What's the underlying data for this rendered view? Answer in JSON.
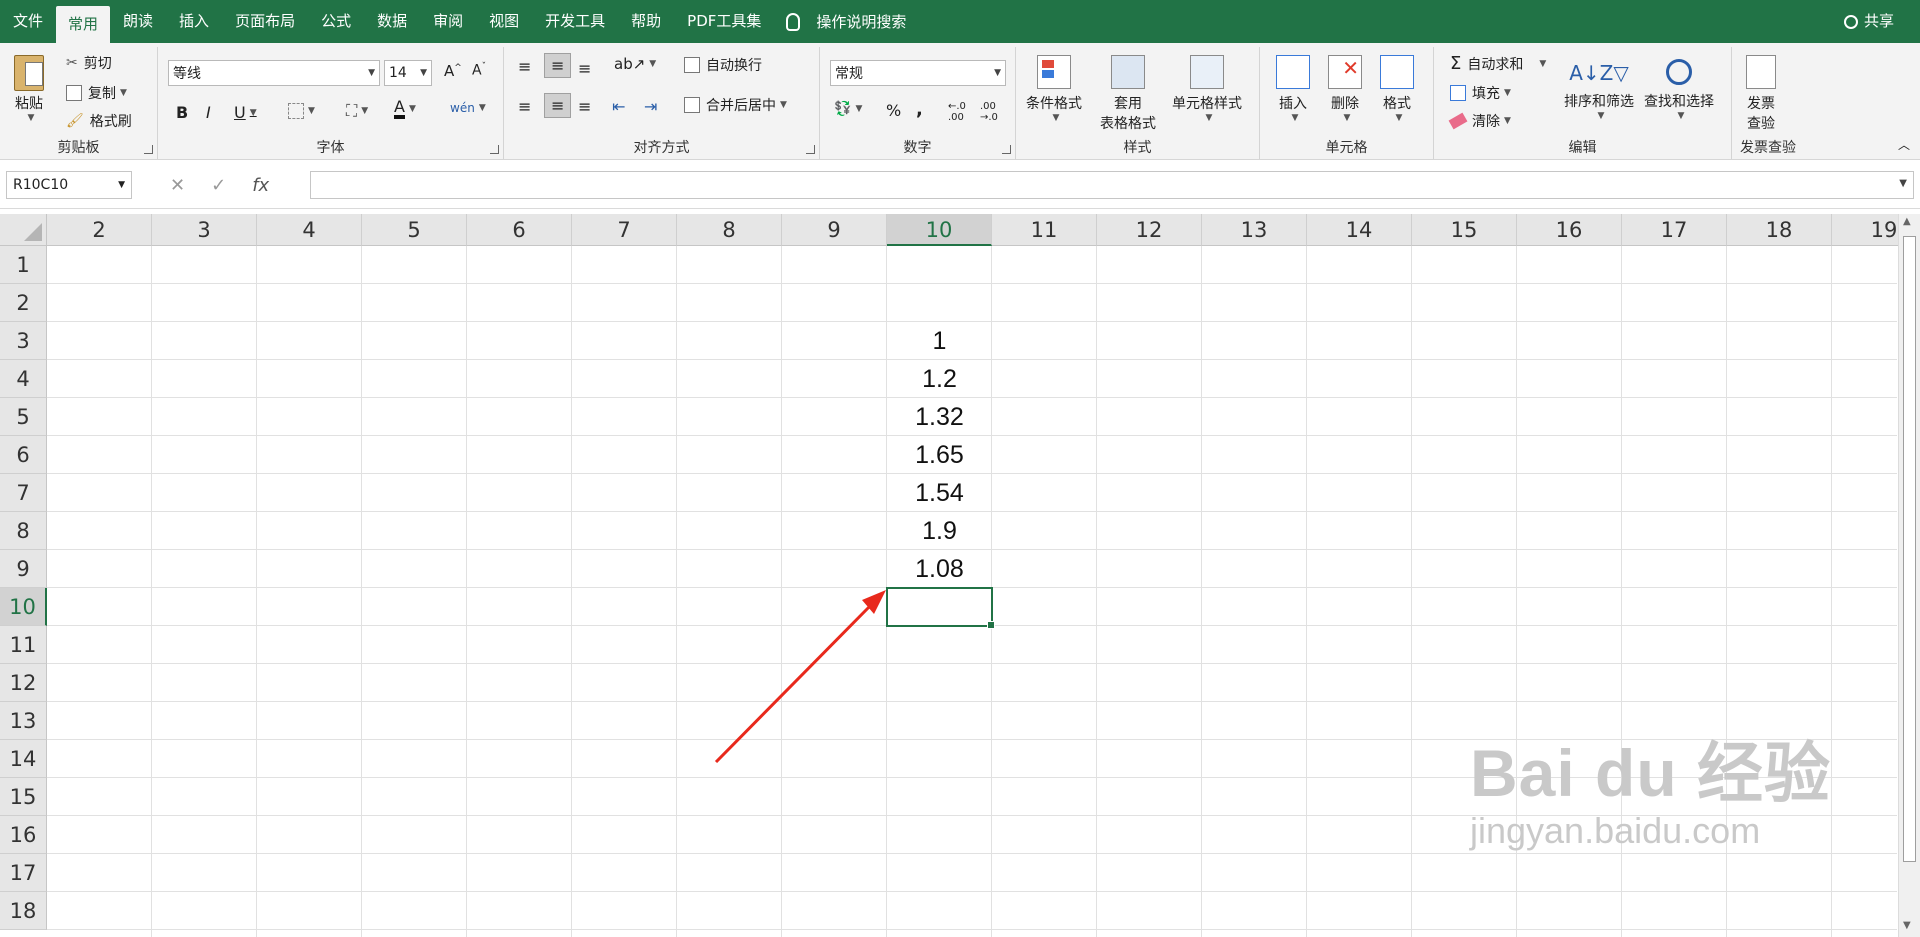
{
  "menubar": {
    "tabs": [
      "文件",
      "常用",
      "朗读",
      "插入",
      "页面布局",
      "公式",
      "数据",
      "审阅",
      "视图",
      "开发工具",
      "帮助",
      "PDF工具集"
    ],
    "active_tab": "常用",
    "tellme": "操作说明搜索",
    "share": "共享"
  },
  "ribbon": {
    "clipboard": {
      "paste": "粘贴",
      "cut": "剪切",
      "copy": "复制",
      "format_painter": "格式刷",
      "label": "剪贴板"
    },
    "font": {
      "name": "等线",
      "size": "14",
      "label": "字体"
    },
    "alignment": {
      "wrap": "自动换行",
      "merge": "合并后居中",
      "label": "对齐方式"
    },
    "number": {
      "format": "常规",
      "label": "数字"
    },
    "styles": {
      "conditional": "条件格式",
      "table_l1": "套用",
      "table_l2": "表格格式",
      "cell_styles": "单元格样式",
      "label": "样式"
    },
    "cells": {
      "insert": "插入",
      "delete": "删除",
      "format": "格式",
      "label": "单元格"
    },
    "editing": {
      "autosum": "自动求和",
      "fill": "填充",
      "clear": "清除",
      "sort": "排序和筛选",
      "find": "查找和选择",
      "label": "编辑"
    },
    "invoice": {
      "l1": "发票",
      "l2": "查验",
      "label": "发票查验"
    }
  },
  "formula_bar": {
    "name_box": "R10C10",
    "formula": ""
  },
  "sheet": {
    "columns": [
      "2",
      "3",
      "4",
      "5",
      "6",
      "7",
      "8",
      "9",
      "10",
      "11",
      "12",
      "13",
      "14",
      "15",
      "16",
      "17",
      "18",
      "19"
    ],
    "rows": [
      "1",
      "2",
      "3",
      "4",
      "5",
      "6",
      "7",
      "8",
      "9",
      "10",
      "11",
      "12",
      "13",
      "14",
      "15",
      "16",
      "17",
      "18"
    ],
    "selected_column": "10",
    "selected_row": "10",
    "values": [
      "1",
      "1.2",
      "1.32",
      "1.65",
      "1.54",
      "1.9",
      "1.08"
    ]
  },
  "watermark": {
    "brand": "Bai du 经验",
    "url": "jingyan.baidu.com"
  }
}
